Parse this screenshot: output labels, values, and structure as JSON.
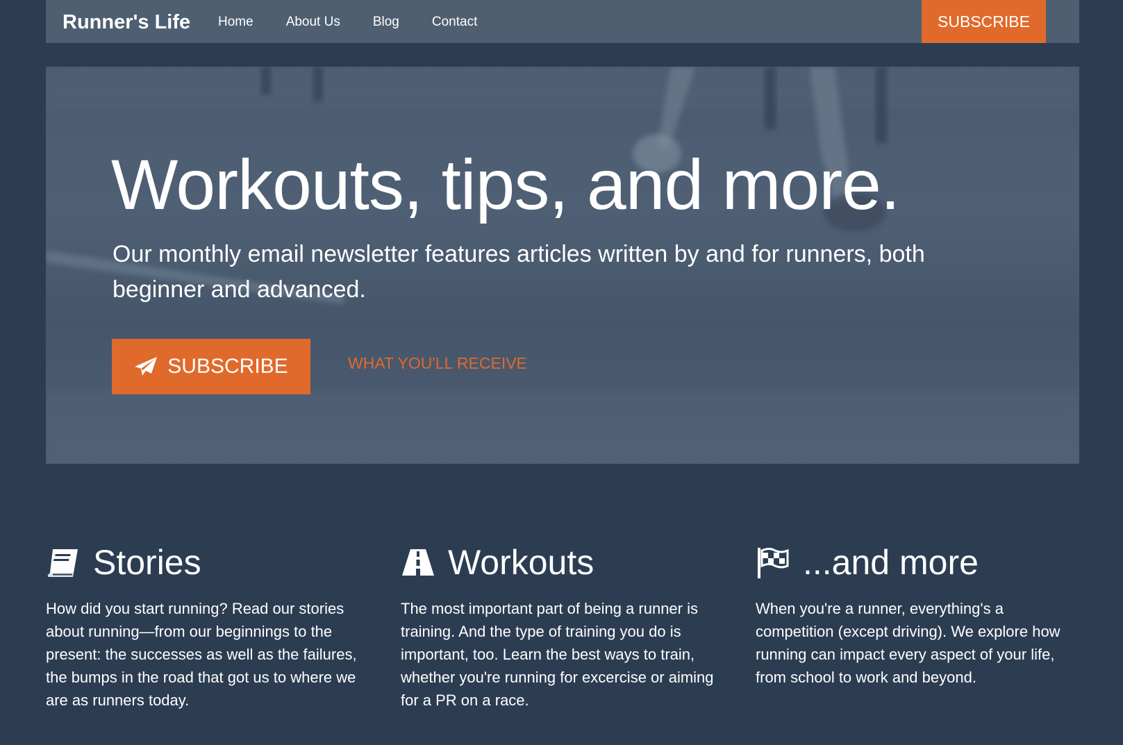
{
  "navbar": {
    "brand": "Runner's Life",
    "links": [
      "Home",
      "About Us",
      "Blog",
      "Contact"
    ],
    "subscribe_label": "SUBSCRIBE"
  },
  "hero": {
    "title": "Workouts, tips, and more.",
    "subtitle": "Our monthly email newsletter features articles written by and for runners, both beginner and advanced.",
    "subscribe_label": "SUBSCRIBE",
    "secondary_link": "WHAT YOU'LL RECEIVE"
  },
  "features": [
    {
      "icon": "book-icon",
      "title": "Stories",
      "text": "How did you start running? Read our stories about running—from our beginnings to the present: the successes as well as the failures, the bumps in the road that got us to where we are as runners today."
    },
    {
      "icon": "road-icon",
      "title": "Workouts",
      "text": "The most important part of being a runner is training. And the type of training you do is important, too. Learn the best ways to train, whether you're running for excercise or aiming for a PR on a race."
    },
    {
      "icon": "flag-checkered-icon",
      "title": "...and more",
      "text": "When you're a runner, everything's a competition (except driving). We explore how running can impact every aspect of your life, from school to work and beyond."
    }
  ],
  "colors": {
    "page_background": "#2c3d52",
    "navbar_background": "#4e5f72",
    "accent": "#e06a2b",
    "text": "#ffffff"
  }
}
